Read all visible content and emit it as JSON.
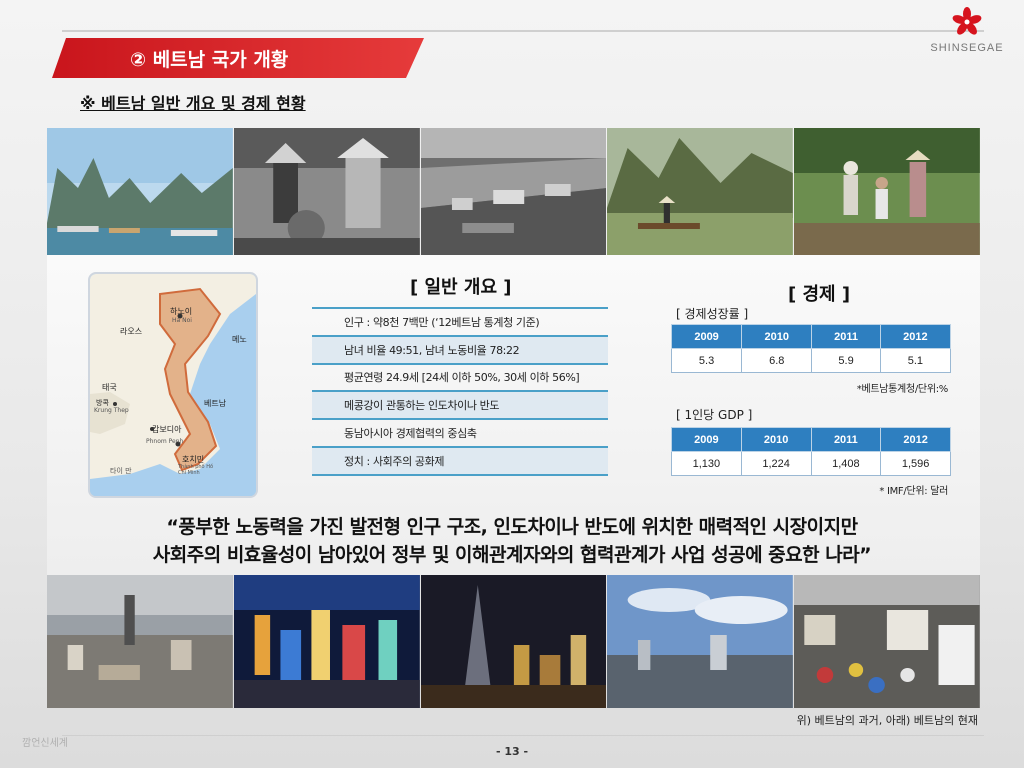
{
  "header": {
    "title": "② 베트남 국가 개황",
    "subtitle": "※ 베트남 일반 개요 및 경제 현황",
    "logo_text": "SHINSEGAE",
    "brand_color": "#d6141e"
  },
  "overview": {
    "heading": "[ 일반 개요 ]",
    "items": [
      "인구 : 약8천 7백만 (‘12베트남 통계청 기준)",
      "남녀 비율 49:51,  남녀 노동비율 78:22",
      "평균연령 24.9세 [24세 이하 50%, 30세 이하 56%]",
      "메콩강이 관통하는 인도차이나 반도",
      "동남아시아 경제협력의 중심축",
      "정치 : 사회주의 공화제"
    ]
  },
  "economy": {
    "heading": "[ 경제 ]",
    "growth": {
      "label": "[ 경제성장률 ]",
      "years": [
        "2009",
        "2010",
        "2011",
        "2012"
      ],
      "values": [
        "5.3",
        "6.8",
        "5.9",
        "5.1"
      ],
      "source": "*베트남통계청/단위:%"
    },
    "gdp": {
      "label": "[ 1인당 GDP ]",
      "years": [
        "2009",
        "2010",
        "2011",
        "2012"
      ],
      "values": [
        "1,130",
        "1,224",
        "1,408",
        "1,596"
      ],
      "source": "* IMF/단위: 달러"
    }
  },
  "map_labels": {
    "hanoi": "하노이",
    "hanoi_en": "Ha Noi",
    "laos": "라오스",
    "gulf": "메노",
    "thailand": "태국",
    "bangkok": "방콕",
    "bangkok_en": "Krung Thep",
    "vietnam": "베트남",
    "cambodia": "캄보디아",
    "phnom_penh": "Phnom Penh",
    "hcmc": "호치민",
    "hcmc_en": "Thành phố Hồ Chí Minh",
    "gulf_thai": "타이 만"
  },
  "quote": {
    "line1": "“풍부한 노동력을 가진 발전형 인구 구조, 인도차이나 반도에 위치한 매력적인 시장이지만",
    "line2": "사회주의 비효율성이 남아있어 정부 및 이해관계자와의 협력관계가 사업 성공에 중요한 나라”"
  },
  "caption": "위) 베트남의 과거, 아래) 베트남의 현재",
  "footer": {
    "watermark": "깜언신세계",
    "page": "- 13 -"
  }
}
